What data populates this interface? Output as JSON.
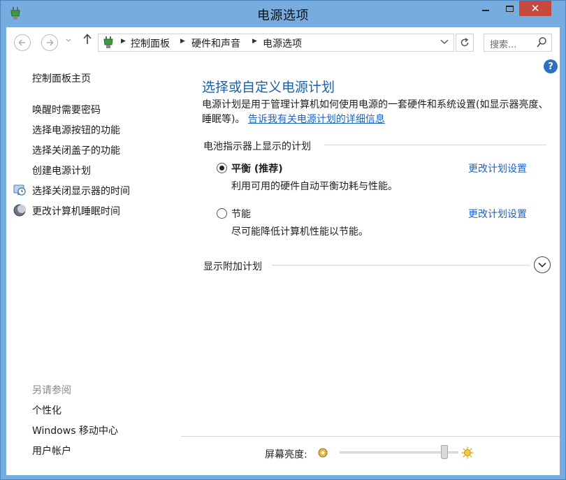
{
  "window": {
    "title": "电源选项",
    "close_glyph": "✕"
  },
  "nav": {
    "back_icon": "arrow-left-icon",
    "forward_icon": "arrow-right-icon",
    "up_icon": "arrow-up-icon",
    "breadcrumbs": [
      "控制面板",
      "硬件和声音",
      "电源选项"
    ],
    "search_placeholder": "搜索..."
  },
  "sidebar": {
    "home": "控制面板主页",
    "links": [
      {
        "label": "唤醒时需要密码"
      },
      {
        "label": "选择电源按钮的功能"
      },
      {
        "label": "选择关闭盖子的功能"
      },
      {
        "label": "创建电源计划"
      },
      {
        "label": "选择关闭显示器的时间",
        "icon": "monitor-clock-icon"
      },
      {
        "label": "更改计算机睡眠时间",
        "icon": "moon-icon"
      }
    ],
    "see_also_title": "另请参阅",
    "see_also": [
      "个性化",
      "Windows 移动中心",
      "用户帐户"
    ]
  },
  "main": {
    "title": "选择或自定义电源计划",
    "description": "电源计划是用于管理计算机如何使用电源的一套硬件和系统设置(如显示器亮度、睡眠等)。",
    "description_link": "告诉我有关电源计划的详细信息",
    "battery_section": "电池指示器上显示的计划",
    "plans": [
      {
        "name": "平衡 (推荐)",
        "description": "利用可用的硬件自动平衡功耗与性能。",
        "link": "更改计划设置",
        "selected": true
      },
      {
        "name": "节能",
        "description": "尽可能降低计算机性能以节能。",
        "link": "更改计划设置",
        "selected": false
      }
    ],
    "more_plans": "显示附加计划"
  },
  "brightness": {
    "label": "屏幕亮度:",
    "level_percent": 88
  },
  "colors": {
    "frame": "#76ace0",
    "close": "#c7483d",
    "title_blue": "#1d5fa8",
    "link_blue": "#1a64c8"
  }
}
